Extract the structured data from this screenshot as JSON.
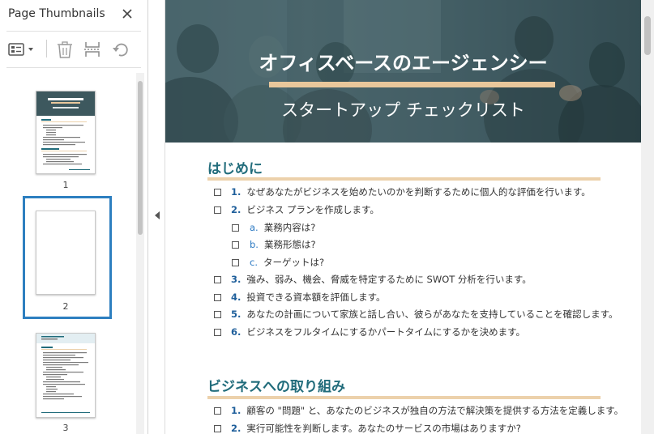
{
  "sidebar": {
    "title": "Page Thumbnails",
    "toolbar": {
      "options_icon": "thumbnail-options-icon",
      "delete_icon": "trash-icon",
      "extract_icon": "page-extract-icon",
      "undo_icon": "rotate-icon"
    },
    "thumbnails": [
      {
        "page": "1"
      },
      {
        "page": "2"
      },
      {
        "page": "3"
      }
    ],
    "selected_page": "2",
    "selection_color": "#2d7fc0"
  },
  "document": {
    "banner": {
      "title": "オフィスベースのエージェンシー",
      "subtitle": "スタートアップ チェックリスト",
      "accent_color": "#e9c79b"
    },
    "sections": [
      {
        "title": "はじめに",
        "items": [
          {
            "num": "1.",
            "text": "なぜあなたがビジネスを始めたいのかを判断するために個人的な評価を行います。"
          },
          {
            "num": "2.",
            "text": "ビジネス プランを作成します。"
          },
          {
            "num": "a.",
            "text": "業務内容は?",
            "sub": true
          },
          {
            "num": "b.",
            "text": "業務形態は?",
            "sub": true
          },
          {
            "num": "c.",
            "text": "ターゲットは?",
            "sub": true
          },
          {
            "num": "3.",
            "text": "強み、弱み、機会、脅威を特定するために SWOT 分析を行います。"
          },
          {
            "num": "4.",
            "text": "投資できる資本額を評価します。"
          },
          {
            "num": "5.",
            "text": "あなたの計画について家族と話し合い、彼らがあなたを支持していることを確認します。"
          },
          {
            "num": "6.",
            "text": "ビジネスをフルタイムにするかパートタイムにするかを決めます。"
          }
        ]
      },
      {
        "title": "ビジネスへの取り組み",
        "items": [
          {
            "num": "1.",
            "text": "顧客の \"問題\" と、あなたのビジネスが独自の方法で解決策を提供する方法を定義します。"
          },
          {
            "num": "2.",
            "text": "実行可能性を判断します。あなたのサービスの市場はありますか?"
          }
        ]
      }
    ],
    "heading_color": "#216c7b",
    "rule_color": "#ecd1ab"
  }
}
